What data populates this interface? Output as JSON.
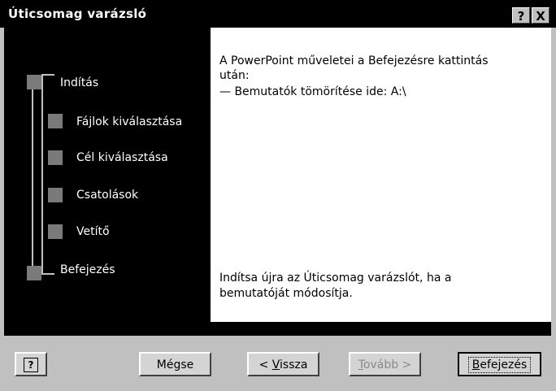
{
  "window": {
    "title": "Úticsomag varázsló",
    "help_glyph": "?",
    "close_glyph": "X"
  },
  "steps": [
    {
      "label": "Indítás"
    },
    {
      "label": "Fájlok kiválasztása"
    },
    {
      "label": "Cél kiválasztása"
    },
    {
      "label": "Csatolások"
    },
    {
      "label": "Vetítő"
    },
    {
      "label": "Befejezés"
    }
  ],
  "content": {
    "intro_line1": "A PowerPoint műveletei a Befejezésre kattintás",
    "intro_line2": "után:",
    "action_item": "— Bemutatók tömörítése ide: A:\\",
    "footer_line1": "Indítsa újra az Úticsomag varázslót, ha a",
    "footer_line2": "bemutatóját módosítja."
  },
  "buttons": {
    "help_icon_glyph": "?",
    "cancel": "Mégse",
    "back_prefix": "< ",
    "back_key": "V",
    "back_rest": "issza",
    "next_key": "T",
    "next_rest": "ovább >",
    "finish_key": "B",
    "finish_rest": "efejezés"
  },
  "colors": {
    "panel_bg": "#000000",
    "dialog_bg": "#c0c0c0",
    "step_square": "#7a7a7a"
  }
}
